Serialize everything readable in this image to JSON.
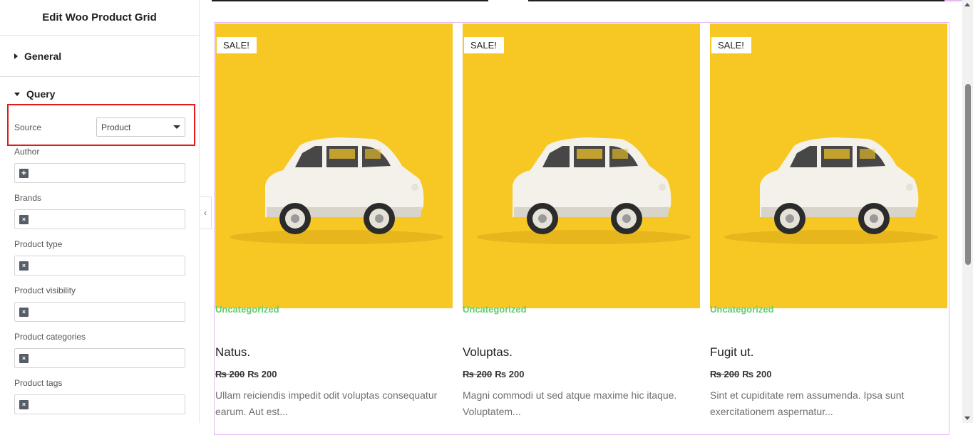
{
  "panel": {
    "title": "Edit Woo Product Grid",
    "sections": {
      "general": "General",
      "query": "Query"
    },
    "source": {
      "label": "Source",
      "value": "Product"
    },
    "fields": [
      {
        "label": "Author",
        "chip": "+"
      },
      {
        "label": "Brands",
        "chip": "×"
      },
      {
        "label": "Product type",
        "chip": "×"
      },
      {
        "label": "Product visibility",
        "chip": "×"
      },
      {
        "label": "Product categories",
        "chip": "×"
      },
      {
        "label": "Product tags",
        "chip": "×"
      }
    ],
    "collapse_icon": "‹"
  },
  "products": [
    {
      "badge": "SALE!",
      "category": "Uncategorized",
      "title": "Natus.",
      "old_price": "₨ 200",
      "price": "₨ 200",
      "description": "Ullam reiciendis impedit odit voluptas consequatur earum. Aut est..."
    },
    {
      "badge": "SALE!",
      "category": "Uncategorized",
      "title": "Voluptas.",
      "old_price": "₨ 200",
      "price": "₨ 200",
      "description": "Magni commodi ut sed atque maxime hic itaque. Voluptatem..."
    },
    {
      "badge": "SALE!",
      "category": "Uncategorized",
      "title": "Fugit ut.",
      "old_price": "₨ 200",
      "price": "₨ 200",
      "description": "Sint et cupiditate rem assumenda. Ipsa sunt exercitationem aspernatur..."
    }
  ],
  "colors": {
    "category": "#61ce70",
    "image_bg": "#f7c824",
    "highlight": "#e21a1a"
  },
  "image_icon": "white-toy-car-image"
}
